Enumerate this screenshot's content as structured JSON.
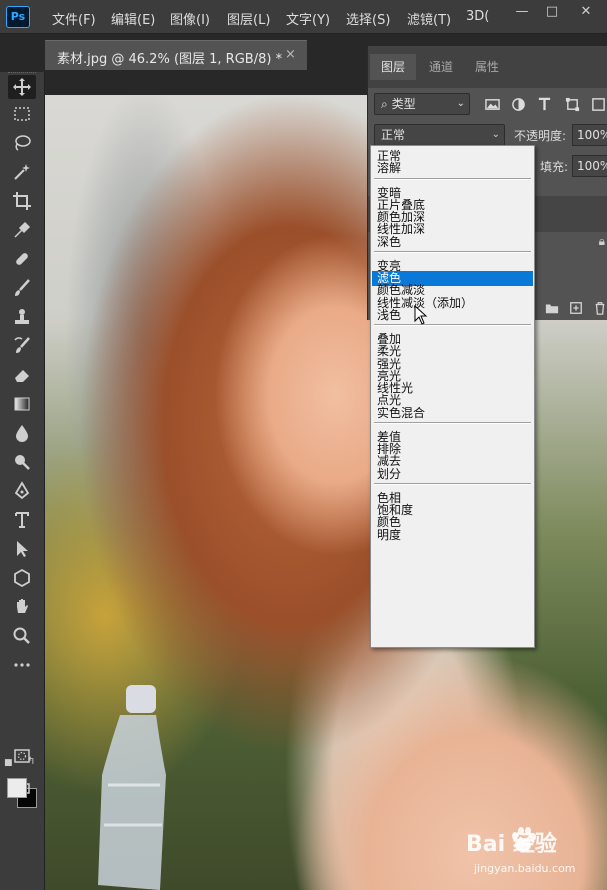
{
  "menubar": {
    "logo": "Ps",
    "items": [
      "文件(F)",
      "编辑(E)",
      "图像(I)",
      "图层(L)",
      "文字(Y)",
      "选择(S)",
      "滤镜(T)",
      "3D("
    ]
  },
  "document": {
    "tab_label": "素材.jpg @ 46.2% (图层 1, RGB/8) *",
    "close_glyph": "×"
  },
  "toolbar": {
    "tools": [
      "move-tool",
      "marquee-tool",
      "lasso-tool",
      "magic-wand-tool",
      "crop-tool",
      "eyedropper-tool",
      "healing-brush-tool",
      "brush-tool",
      "clone-stamp-tool",
      "history-brush-tool",
      "eraser-tool",
      "gradient-tool",
      "blur-tool",
      "dodge-tool",
      "pen-tool",
      "type-tool",
      "path-selection-tool",
      "shape-tool",
      "hand-tool",
      "zoom-tool",
      "more-tools"
    ],
    "foreground_color": "#ececec",
    "background_color": "#050505"
  },
  "layers_panel": {
    "tabs": [
      "图层",
      "通道",
      "属性"
    ],
    "active_tab": "图层",
    "filter_label": "类型",
    "blend_mode": "正常",
    "opacity_label": "不透明度:",
    "opacity_value": "100%",
    "fill_label": "填充:",
    "fill_value": "100%"
  },
  "blend_dropdown": {
    "groups": [
      [
        "正常",
        "溶解"
      ],
      [
        "变暗",
        "正片叠底",
        "颜色加深",
        "线性加深",
        "深色"
      ],
      [
        "变亮",
        "滤色",
        "颜色减淡",
        "线性减淡（添加）",
        "浅色"
      ],
      [
        "叠加",
        "柔光",
        "强光",
        "亮光",
        "线性光",
        "点光",
        "实色混合"
      ],
      [
        "差值",
        "排除",
        "减去",
        "划分"
      ],
      [
        "色相",
        "饱和度",
        "颜色",
        "明度"
      ]
    ],
    "highlighted": "滤色"
  },
  "watermark": {
    "brand": "Bai 经验",
    "url": "jingyan.baidu.com"
  },
  "colors": {
    "accent": "#0a78d7",
    "ps_blue": "#31a8ff",
    "chrome": "#3c3c3c",
    "panel": "#535353"
  }
}
